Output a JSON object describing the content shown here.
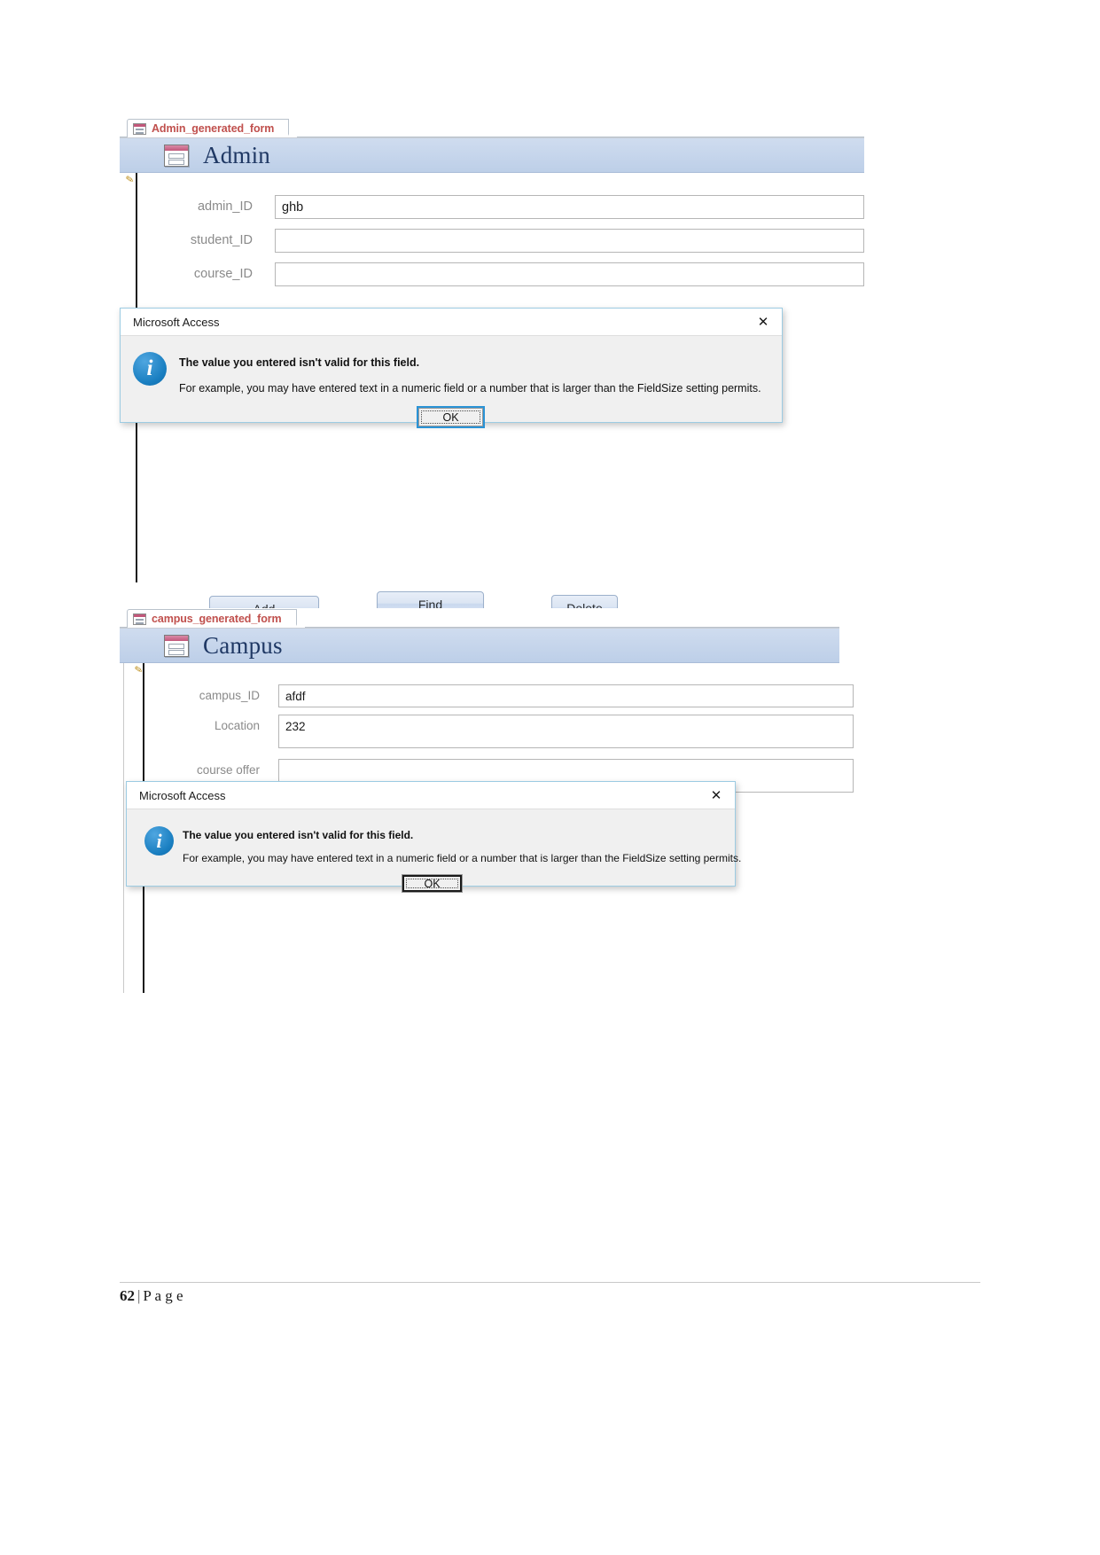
{
  "page": {
    "footer_number": "62",
    "footer_separator": "|",
    "footer_label": "P a g e"
  },
  "admin_form": {
    "tab": {
      "label": "Admin_generated_form",
      "icon": "form-icon"
    },
    "header": {
      "title": "Admin",
      "icon": "form-icon"
    },
    "fields": [
      {
        "label": "admin_ID",
        "value": "ghb",
        "placeholder": ""
      },
      {
        "label": "student_ID",
        "value": "",
        "placeholder": ""
      },
      {
        "label": "course_ID",
        "value": "",
        "placeholder": ""
      }
    ],
    "buttons": [
      {
        "label": "Add"
      },
      {
        "label": "Find"
      },
      {
        "label": "Delete"
      }
    ]
  },
  "admin_dialog": {
    "title": "Microsoft Access",
    "close_icon": "close-icon",
    "info_icon": "info-icon",
    "info_glyph": "i",
    "line1": "The value you entered isn't valid for this field.",
    "line2": "For example, you may have entered text in a numeric field or a number that is larger than the FieldSize setting permits.",
    "ok_label": "OK"
  },
  "campus_form": {
    "tab": {
      "label": "campus_generated_form",
      "icon": "form-icon"
    },
    "header": {
      "title": "Campus",
      "icon": "form-icon"
    },
    "fields": [
      {
        "label": "campus_ID",
        "value": "afdf",
        "placeholder": ""
      },
      {
        "label": "Location",
        "value": "232",
        "placeholder": ""
      },
      {
        "label": "course offer",
        "value": "",
        "placeholder": ""
      }
    ]
  },
  "campus_dialog": {
    "title": "Microsoft Access",
    "close_icon": "close-icon",
    "info_icon": "info-icon",
    "info_glyph": "i",
    "line1": "The value you entered isn't valid for this field.",
    "line2": "For example, you may have entered text in a numeric field or a number that is larger than the FieldSize setting permits.",
    "ok_label": "OK"
  },
  "colors": {
    "tab_label": "#c0504d",
    "form_title": "#1f3864",
    "header_band": "#c5d5ec",
    "info_blue": "#1a7fc1",
    "focus_blue": "#2a93d6"
  }
}
